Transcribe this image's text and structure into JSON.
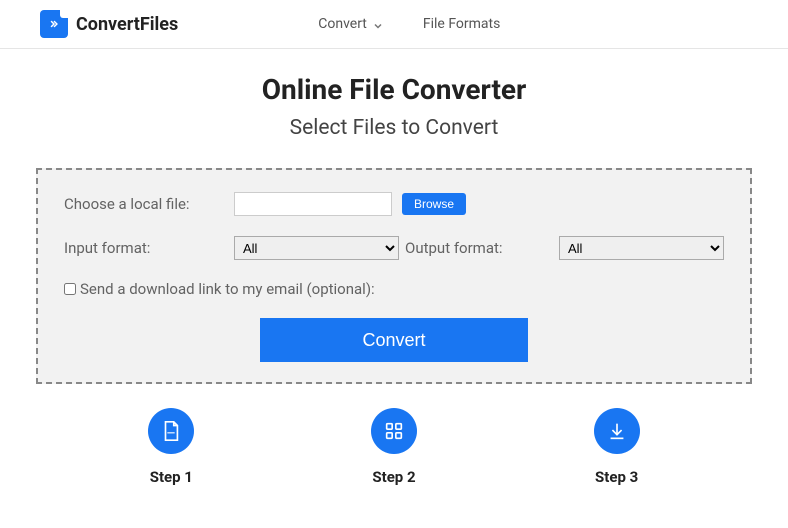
{
  "brand": "ConvertFiles",
  "nav": {
    "convert": "Convert",
    "formats": "File Formats"
  },
  "hero": {
    "title": "Online File Converter",
    "subtitle": "Select Files to Convert"
  },
  "form": {
    "choose_label": "Choose a local file:",
    "browse_label": "Browse",
    "input_format_label": "Input format:",
    "input_format_value": "All",
    "output_format_label": "Output format:",
    "output_format_value": "All",
    "email_checkbox_label": "Send a download link to my email (optional):",
    "convert_label": "Convert"
  },
  "steps": {
    "s1": "Step 1",
    "s2": "Step 2",
    "s3": "Step 3"
  }
}
